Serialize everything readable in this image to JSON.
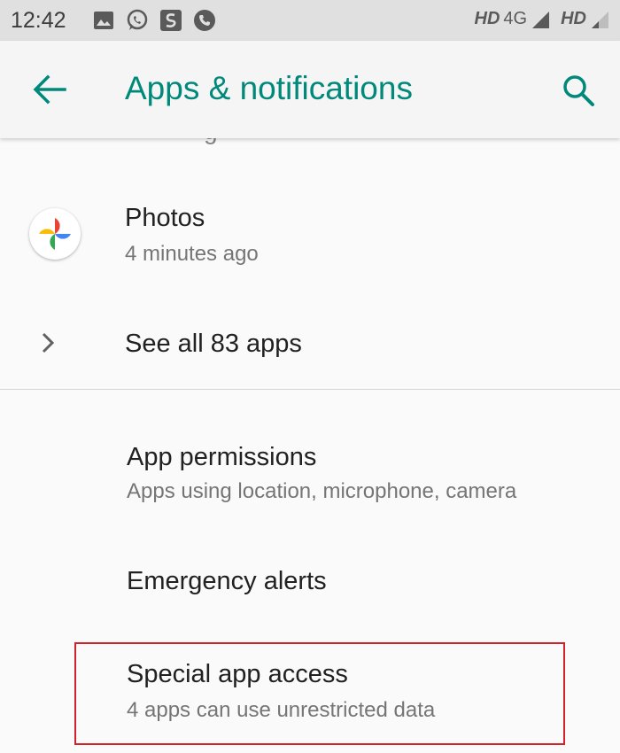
{
  "status_bar": {
    "time": "12:42",
    "left_icons": [
      "gallery-icon",
      "whatsapp-icon",
      "s-app-icon",
      "phone-icon"
    ],
    "hd1": "HD",
    "network": "4G",
    "hd2": "HD"
  },
  "app_bar": {
    "title": "Apps & notifications",
    "accent_color": "#00897b"
  },
  "clipped_text": "g",
  "recent_app": {
    "name": "Photos",
    "time": "4 minutes ago"
  },
  "see_all": {
    "label": "See all 83 apps"
  },
  "settings": [
    {
      "title": "App permissions",
      "subtitle": "Apps using location, microphone, camera"
    },
    {
      "title": "Emergency alerts"
    },
    {
      "title": "Special app access",
      "subtitle": "4 apps can use unrestricted data"
    }
  ],
  "highlight_color": "#d0222a"
}
